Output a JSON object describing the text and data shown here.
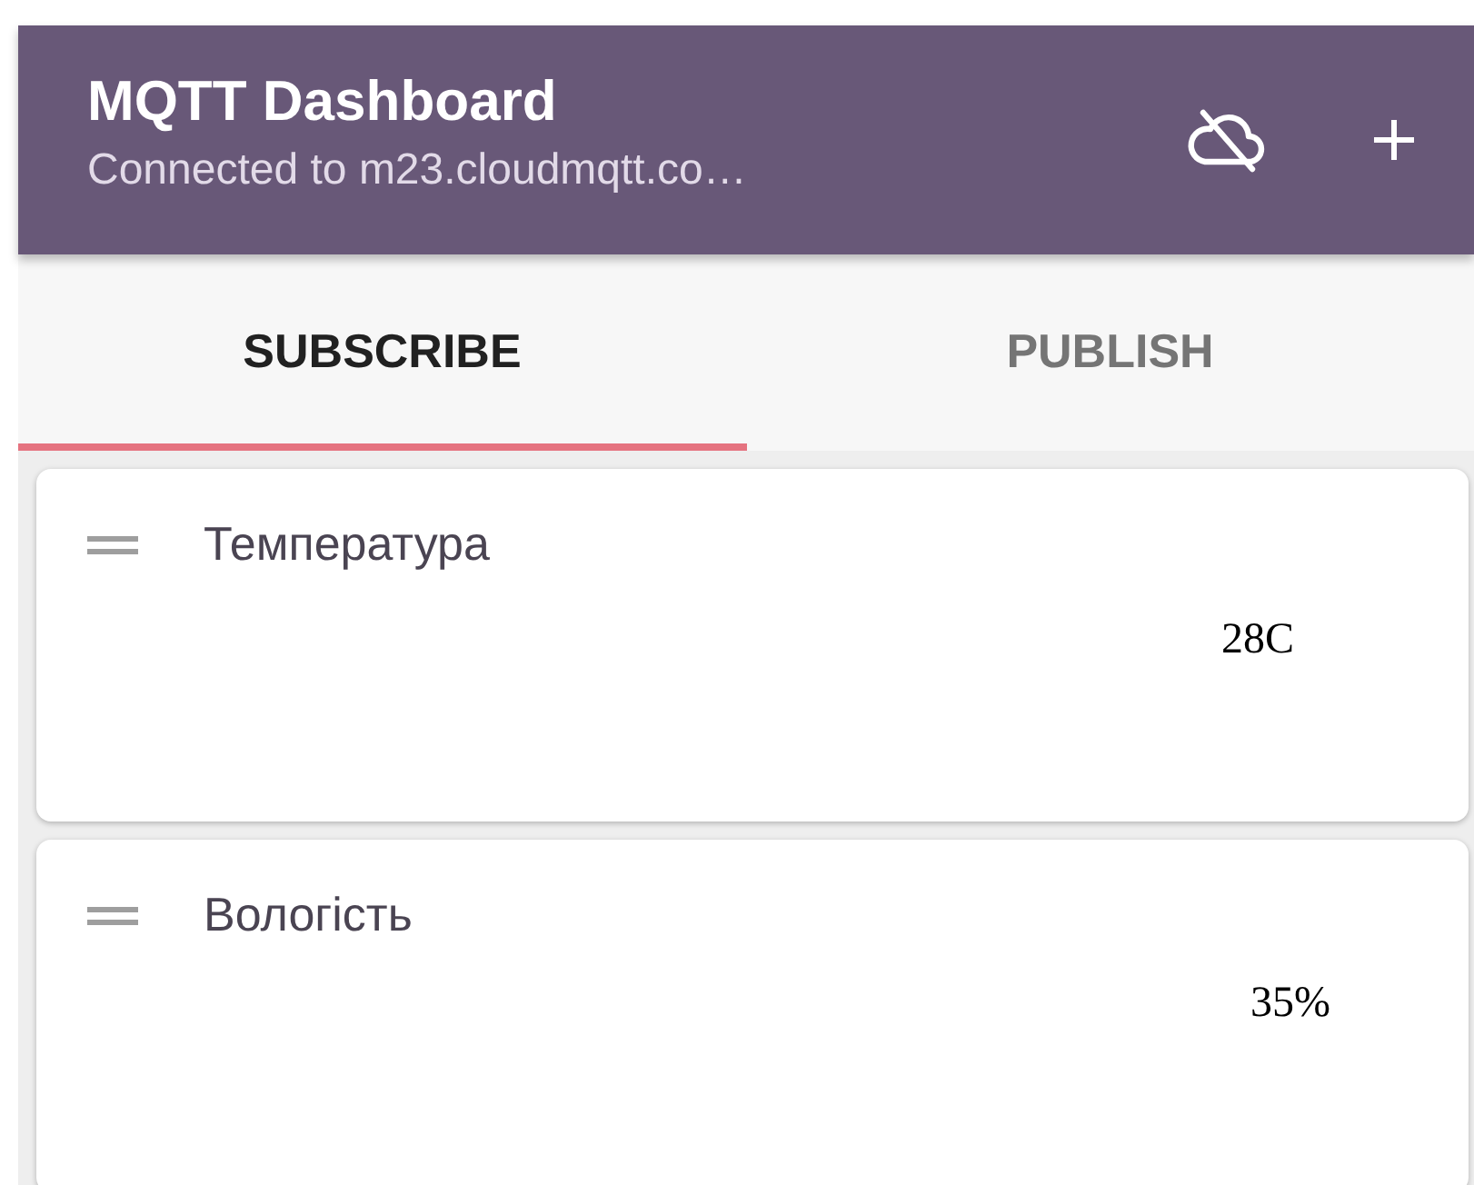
{
  "app_bar": {
    "title": "MQTT Dashboard",
    "subtitle": "Connected to m23.cloudmqtt.co…"
  },
  "tabs": [
    {
      "label": "SUBSCRIBE",
      "selected": true
    },
    {
      "label": "PUBLISH",
      "selected": false
    }
  ],
  "cards": [
    {
      "name": "Температура",
      "value": "28C"
    },
    {
      "name": "Вологість",
      "value": "35%"
    }
  ]
}
